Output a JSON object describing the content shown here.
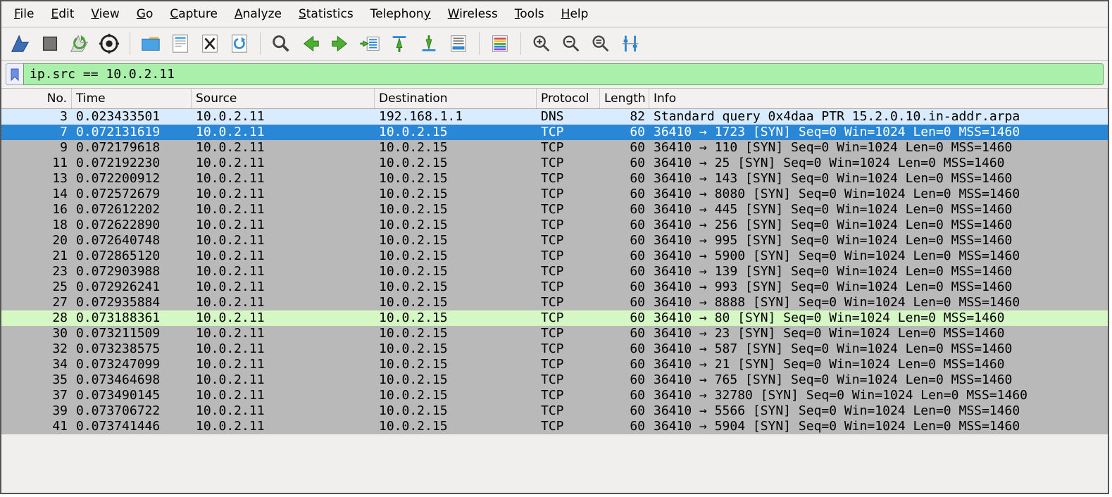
{
  "menu": {
    "items": [
      {
        "label": "File",
        "u": 0
      },
      {
        "label": "Edit",
        "u": 0
      },
      {
        "label": "View",
        "u": 0
      },
      {
        "label": "Go",
        "u": 0
      },
      {
        "label": "Capture",
        "u": 0
      },
      {
        "label": "Analyze",
        "u": 0
      },
      {
        "label": "Statistics",
        "u": 0
      },
      {
        "label": "Telephony",
        "u": 8
      },
      {
        "label": "Wireless",
        "u": 0
      },
      {
        "label": "Tools",
        "u": 0
      },
      {
        "label": "Help",
        "u": 0
      }
    ]
  },
  "filter": {
    "value": "ip.src == 10.0.2.11"
  },
  "columns": {
    "no": "No.",
    "time": "Time",
    "src": "Source",
    "dst": "Destination",
    "proto": "Protocol",
    "len": "Length",
    "info": "Info"
  },
  "packets": [
    {
      "no": 3,
      "time": "0.023433501",
      "src": "10.0.2.11",
      "dst": "192.168.1.1",
      "proto": "DNS",
      "len": 82,
      "info": "Standard query 0x4daa PTR 15.2.0.10.in-addr.arpa",
      "style": "dns"
    },
    {
      "no": 7,
      "time": "0.072131619",
      "src": "10.0.2.11",
      "dst": "10.0.2.15",
      "proto": "TCP",
      "len": 60,
      "info": "36410 → 1723 [SYN] Seq=0 Win=1024 Len=0 MSS=1460",
      "style": "sel"
    },
    {
      "no": 9,
      "time": "0.072179618",
      "src": "10.0.2.11",
      "dst": "10.0.2.15",
      "proto": "TCP",
      "len": 60,
      "info": "36410 → 110 [SYN] Seq=0 Win=1024 Len=0 MSS=1460",
      "style": "grey"
    },
    {
      "no": 11,
      "time": "0.072192230",
      "src": "10.0.2.11",
      "dst": "10.0.2.15",
      "proto": "TCP",
      "len": 60,
      "info": "36410 → 25 [SYN] Seq=0 Win=1024 Len=0 MSS=1460",
      "style": "grey"
    },
    {
      "no": 13,
      "time": "0.072200912",
      "src": "10.0.2.11",
      "dst": "10.0.2.15",
      "proto": "TCP",
      "len": 60,
      "info": "36410 → 143 [SYN] Seq=0 Win=1024 Len=0 MSS=1460",
      "style": "grey"
    },
    {
      "no": 14,
      "time": "0.072572679",
      "src": "10.0.2.11",
      "dst": "10.0.2.15",
      "proto": "TCP",
      "len": 60,
      "info": "36410 → 8080 [SYN] Seq=0 Win=1024 Len=0 MSS=1460",
      "style": "grey"
    },
    {
      "no": 16,
      "time": "0.072612202",
      "src": "10.0.2.11",
      "dst": "10.0.2.15",
      "proto": "TCP",
      "len": 60,
      "info": "36410 → 445 [SYN] Seq=0 Win=1024 Len=0 MSS=1460",
      "style": "grey"
    },
    {
      "no": 18,
      "time": "0.072622890",
      "src": "10.0.2.11",
      "dst": "10.0.2.15",
      "proto": "TCP",
      "len": 60,
      "info": "36410 → 256 [SYN] Seq=0 Win=1024 Len=0 MSS=1460",
      "style": "grey"
    },
    {
      "no": 20,
      "time": "0.072640748",
      "src": "10.0.2.11",
      "dst": "10.0.2.15",
      "proto": "TCP",
      "len": 60,
      "info": "36410 → 995 [SYN] Seq=0 Win=1024 Len=0 MSS=1460",
      "style": "grey"
    },
    {
      "no": 21,
      "time": "0.072865120",
      "src": "10.0.2.11",
      "dst": "10.0.2.15",
      "proto": "TCP",
      "len": 60,
      "info": "36410 → 5900 [SYN] Seq=0 Win=1024 Len=0 MSS=1460",
      "style": "grey"
    },
    {
      "no": 23,
      "time": "0.072903988",
      "src": "10.0.2.11",
      "dst": "10.0.2.15",
      "proto": "TCP",
      "len": 60,
      "info": "36410 → 139 [SYN] Seq=0 Win=1024 Len=0 MSS=1460",
      "style": "grey"
    },
    {
      "no": 25,
      "time": "0.072926241",
      "src": "10.0.2.11",
      "dst": "10.0.2.15",
      "proto": "TCP",
      "len": 60,
      "info": "36410 → 993 [SYN] Seq=0 Win=1024 Len=0 MSS=1460",
      "style": "grey"
    },
    {
      "no": 27,
      "time": "0.072935884",
      "src": "10.0.2.11",
      "dst": "10.0.2.15",
      "proto": "TCP",
      "len": 60,
      "info": "36410 → 8888 [SYN] Seq=0 Win=1024 Len=0 MSS=1460",
      "style": "grey"
    },
    {
      "no": 28,
      "time": "0.073188361",
      "src": "10.0.2.11",
      "dst": "10.0.2.15",
      "proto": "TCP",
      "len": 60,
      "info": "36410 → 80 [SYN] Seq=0 Win=1024 Len=0 MSS=1460",
      "style": "http"
    },
    {
      "no": 30,
      "time": "0.073211509",
      "src": "10.0.2.11",
      "dst": "10.0.2.15",
      "proto": "TCP",
      "len": 60,
      "info": "36410 → 23 [SYN] Seq=0 Win=1024 Len=0 MSS=1460",
      "style": "grey"
    },
    {
      "no": 32,
      "time": "0.073238575",
      "src": "10.0.2.11",
      "dst": "10.0.2.15",
      "proto": "TCP",
      "len": 60,
      "info": "36410 → 587 [SYN] Seq=0 Win=1024 Len=0 MSS=1460",
      "style": "grey"
    },
    {
      "no": 34,
      "time": "0.073247099",
      "src": "10.0.2.11",
      "dst": "10.0.2.15",
      "proto": "TCP",
      "len": 60,
      "info": "36410 → 21 [SYN] Seq=0 Win=1024 Len=0 MSS=1460",
      "style": "grey"
    },
    {
      "no": 35,
      "time": "0.073464698",
      "src": "10.0.2.11",
      "dst": "10.0.2.15",
      "proto": "TCP",
      "len": 60,
      "info": "36410 → 765 [SYN] Seq=0 Win=1024 Len=0 MSS=1460",
      "style": "grey"
    },
    {
      "no": 37,
      "time": "0.073490145",
      "src": "10.0.2.11",
      "dst": "10.0.2.15",
      "proto": "TCP",
      "len": 60,
      "info": "36410 → 32780 [SYN] Seq=0 Win=1024 Len=0 MSS=1460",
      "style": "grey"
    },
    {
      "no": 39,
      "time": "0.073706722",
      "src": "10.0.2.11",
      "dst": "10.0.2.15",
      "proto": "TCP",
      "len": 60,
      "info": "36410 → 5566 [SYN] Seq=0 Win=1024 Len=0 MSS=1460",
      "style": "grey"
    },
    {
      "no": 41,
      "time": "0.073741446",
      "src": "10.0.2.11",
      "dst": "10.0.2.15",
      "proto": "TCP",
      "len": 60,
      "info": "36410 → 5904 [SYN] Seq=0 Win=1024 Len=0 MSS=1460",
      "style": "grey"
    }
  ]
}
